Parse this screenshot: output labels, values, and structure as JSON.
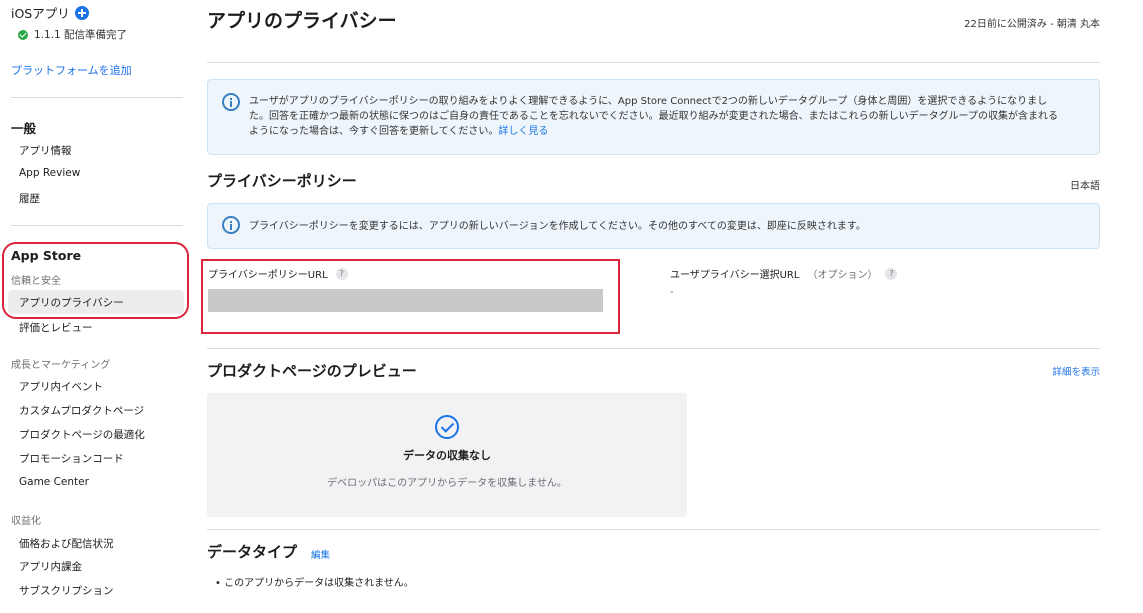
{
  "sidebar": {
    "app_name": "iOSアプリ",
    "version_status": "1.1.1 配信準備完了",
    "add_platform": "プラットフォームを追加",
    "general": {
      "heading": "一般",
      "items": [
        "アプリ情報",
        "App Review",
        "履歴"
      ]
    },
    "app_store": {
      "heading": "App Store",
      "trust_heading": "信頼と安全",
      "selected_item": "アプリのプライバシー",
      "items": [
        "評価とレビュー"
      ]
    },
    "growth": {
      "heading": "成長とマーケティング",
      "items": [
        "アプリ内イベント",
        "カスタムプロダクトページ",
        "プロダクトページの最適化",
        "プロモーションコード",
        "Game Center"
      ]
    },
    "monetization": {
      "heading": "収益化",
      "items": [
        "価格および配信状況",
        "アプリ内課金",
        "サブスクリプション"
      ]
    }
  },
  "main": {
    "title": "アプリのプライバシー",
    "publish_status": "22日前に公開済み - 朝清 丸本",
    "notice": {
      "line1": "ユーザがアプリのプライバシーポリシーの取り組みをよりよく理解できるように、App Store Connectで2つの新しいデータグループ（身体と周囲）を選択できるようになりまし",
      "line2": "た。回答を正確かつ最新の状態に保つのはご自身の責任であることを忘れないでください。最近取り組みが変更された場合、またはこれらの新しいデータグループの収集が含まれる",
      "line3": "ようになった場合は、今すぐ回答を更新してください。",
      "link": "詳しく見る"
    },
    "privacy_policy": {
      "heading": "プライバシーポリシー",
      "language": "日本語",
      "notice": "プライバシーポリシーを変更するには、アプリの新しいバージョンを作成してください。その他のすべての変更は、即座に反映されます。",
      "url_label": "プライバシーポリシーURL",
      "user_choice_label": "ユーザプライバシー選択URL",
      "optional": "（オプション）",
      "user_choice_value": "-",
      "help": "?"
    },
    "product_preview": {
      "heading": "プロダクトページのプレビュー",
      "details_link": "詳細を表示",
      "title": "データの収集なし",
      "description": "デベロッパはこのアプリからデータを収集しません。"
    },
    "data_types": {
      "heading": "データタイプ",
      "edit_link": "編集",
      "bullet": "•  このアプリからデータは収集されません。"
    }
  }
}
